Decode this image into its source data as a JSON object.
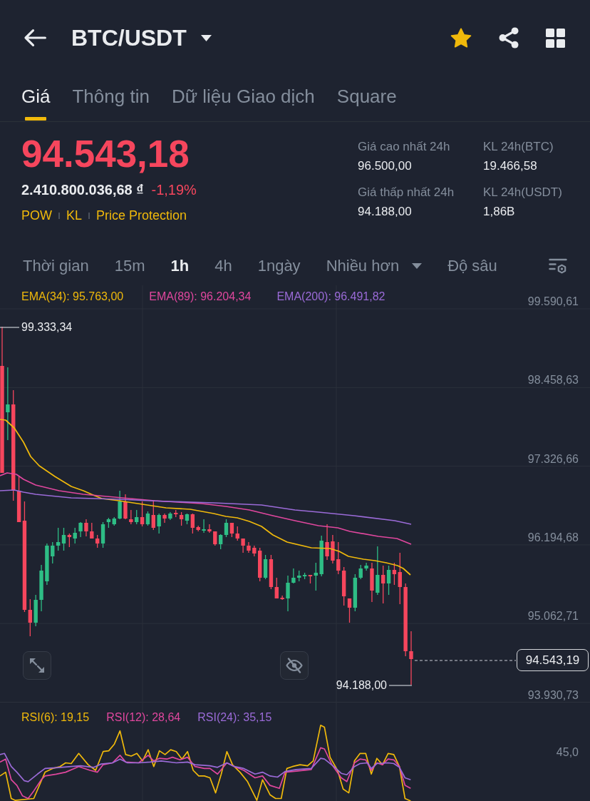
{
  "header": {
    "title": "BTC/USDT",
    "favorite": true
  },
  "tabs": [
    {
      "label": "Giá",
      "selected": true
    },
    {
      "label": "Thông tin",
      "selected": false
    },
    {
      "label": "Dữ liệu Giao dịch",
      "selected": false
    },
    {
      "label": "Square",
      "selected": false
    }
  ],
  "price": {
    "last": "94.543,18",
    "fiat": "2.410.800.036,68 ₫",
    "change": "-1,19%",
    "falling": true
  },
  "tags": [
    "POW",
    "KL",
    "Price Protection"
  ],
  "stats": [
    {
      "label": "Giá cao nhất 24h",
      "value": "96.500,00"
    },
    {
      "label": "KL 24h(BTC)",
      "value": "19.466,58"
    },
    {
      "label": "Giá thấp nhất 24h",
      "value": "94.188,00"
    },
    {
      "label": "KL 24h(USDT)",
      "value": "1,86B"
    }
  ],
  "intervals": [
    {
      "label": "Thời gian",
      "kind": "tab",
      "selected": false
    },
    {
      "label": "15m",
      "kind": "tab",
      "selected": false
    },
    {
      "label": "1h",
      "kind": "tab",
      "selected": true
    },
    {
      "label": "4h",
      "kind": "tab",
      "selected": false
    },
    {
      "label": "1ngày",
      "kind": "tab",
      "selected": false
    },
    {
      "label": "Nhiều hơn",
      "kind": "dropdown",
      "selected": false
    },
    {
      "label": "Độ sâu",
      "kind": "tab",
      "selected": false
    }
  ],
  "chart": {
    "indicators": [
      {
        "label": "EMA(34): 95.763,00",
        "color": "#f0b90b"
      },
      {
        "label": "EMA(89): 96.204,34",
        "color": "#e0479e"
      },
      {
        "label": "EMA(200): 96.491,82",
        "color": "#9b6bd8"
      }
    ],
    "price_axis": [
      "99.590,61",
      "98.458,63",
      "97.326,66",
      "96.194,68",
      "95.062,71",
      "93.930,73"
    ],
    "high_label": "99.333,34",
    "low_label": "94.188,00",
    "current_price": "94.543,19"
  },
  "rsi": {
    "indicators": [
      {
        "label": "RSI(6): 19,15",
        "color": "#f0b90b"
      },
      {
        "label": "RSI(12): 28,64",
        "color": "#e0479e"
      },
      {
        "label": "RSI(24): 35,15",
        "color": "#9b6bd8"
      }
    ],
    "axis_label": "45,0"
  }
}
